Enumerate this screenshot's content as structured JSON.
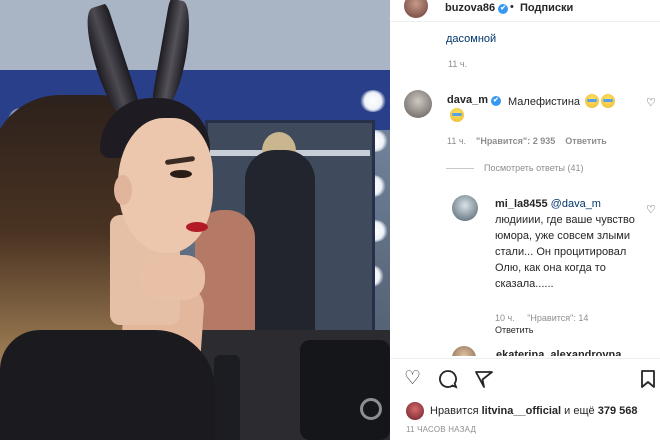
{
  "header": {
    "username": "buzova86",
    "verified_badge": "✔",
    "separator": "•",
    "follow_label": "Подписки"
  },
  "previous_comment": {
    "text": "дасомной",
    "time": "11 ч."
  },
  "comment_1": {
    "username": "dava_m",
    "verified_badge": "✔",
    "text": "Малефистина",
    "time": "11 ч.",
    "likes": "\"Нравится\": 2 935",
    "reply_label": "Ответить",
    "heart_icon": "♡"
  },
  "view_replies": "Посмотреть ответы (41)",
  "reply_1": {
    "username": "mi_la8455",
    "mention": "@dava_m",
    "text": "людииии, где ваше чувство юмора, уже совсем злыми стали... Он процитировал Олю, как она когда то сказала......",
    "time": "10 ч.",
    "likes": "\"Нравится\": 14",
    "reply_label": "Ответить",
    "heart_icon": "♡"
  },
  "comment_2_peek": {
    "username": "ekaterina_alexandrovna"
  },
  "actions": {
    "like_icon": "♡",
    "comment_icon": "◯",
    "share_icon": "➢",
    "save_icon": "⊓"
  },
  "likes_summary": {
    "prefix": "Нравится",
    "user": "litvina__official",
    "conjunction": "и ещё",
    "count": "379 568"
  },
  "timestamp": "11 ЧАСОВ НАЗАД"
}
